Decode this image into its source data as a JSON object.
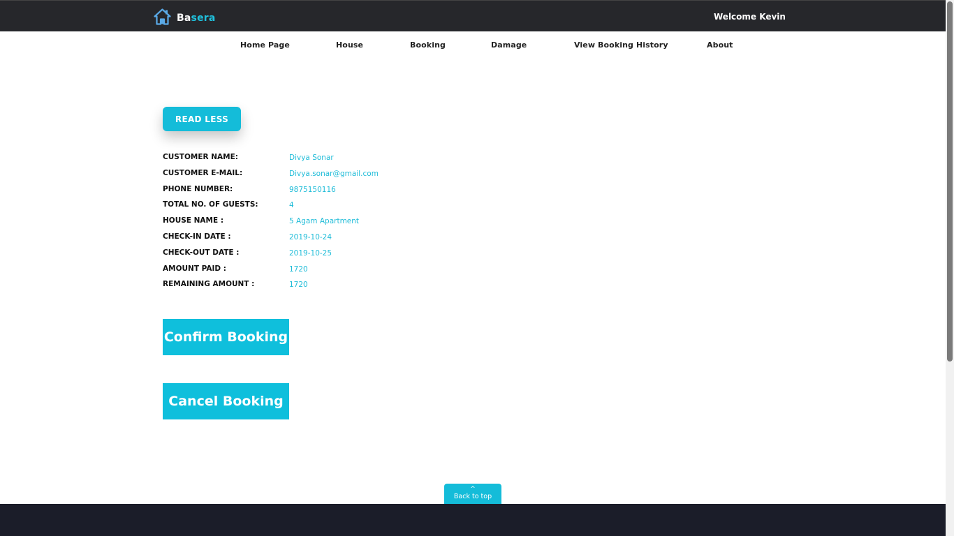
{
  "header": {
    "logo_prefix": "Ba",
    "logo_suffix": "sera",
    "logo_icon": "house-icon",
    "welcome": "Welcome Kevin",
    "brand_color": "#1fc0dc"
  },
  "nav": {
    "items": [
      {
        "label": "Home Page"
      },
      {
        "label": "House"
      },
      {
        "label": "Booking"
      },
      {
        "label": "Damage"
      },
      {
        "label": "View Booking History"
      },
      {
        "label": "About"
      }
    ]
  },
  "main": {
    "read_less_label": "READ LESS",
    "details": [
      {
        "label": "CUSTOMER NAME:",
        "value": "Divya Sonar"
      },
      {
        "label": "CUSTOMER E-MAIL:",
        "value": "Divya.sonar@gmail.com"
      },
      {
        "label": "PHONE NUMBER:",
        "value": "9875150116"
      },
      {
        "label": "TOTAL NO. OF GUESTS:",
        "value": "4"
      },
      {
        "label": "HOUSE NAME :",
        "value": "5 Agam Apartment"
      },
      {
        "label": "CHECK-IN DATE :",
        "value": "2019-10-24"
      },
      {
        "label": "CHECK-OUT DATE :",
        "value": "2019-10-25"
      },
      {
        "label": "AMOUNT PAID :",
        "value": "1720"
      },
      {
        "label": "REMAINING AMOUNT :",
        "value": "1720"
      }
    ],
    "confirm_label": "Confirm Booking",
    "cancel_label": "Cancel Booking"
  },
  "back_to_top": {
    "label": "Back to top",
    "icon": "chevron-up-icon"
  }
}
